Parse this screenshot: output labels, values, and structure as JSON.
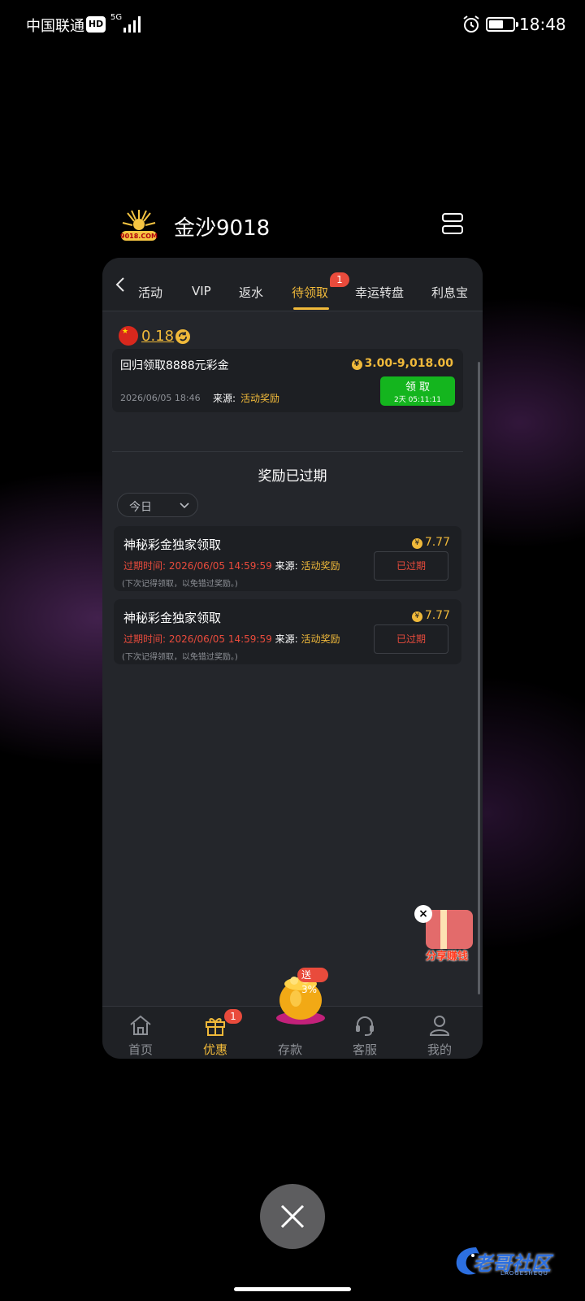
{
  "status_bar": {
    "carrier": "中国联通",
    "hd": "HD",
    "network": "5G",
    "time": "18:48",
    "battery_level": 0.6
  },
  "app": {
    "title": "金沙9018",
    "logo_text": "9018.COM"
  },
  "tabs": [
    {
      "label": "活动"
    },
    {
      "label": "VIP"
    },
    {
      "label": "返水"
    },
    {
      "label": "待领取",
      "active": true,
      "badge": "1"
    },
    {
      "label": "幸运转盘"
    },
    {
      "label": "利息宝"
    }
  ],
  "balance": {
    "flag": "china-flag-icon",
    "value": "0.18"
  },
  "pending": {
    "title": "回归领取8888元彩金",
    "currency_symbol": "¥",
    "amount_range": "3.00-9,018.00",
    "date": "2026/06/05 18:46",
    "source_label": "来源:",
    "source_value": "活动奖励",
    "claim_label": "领 取",
    "claim_timer": "2天 05:11:11"
  },
  "expired_section": {
    "title": "奖励已过期",
    "date_filter": "今日",
    "items": [
      {
        "title": "神秘彩金独家领取",
        "amount": "7.77",
        "time_label": "过期时间:",
        "time_value": "2026/06/05 14:59:59",
        "source_label": "来源:",
        "source_value": "活动奖励",
        "note": "(下次记得领取，以免错过奖励。)",
        "status": "已过期"
      },
      {
        "title": "神秘彩金独家领取",
        "amount": "7.77",
        "time_label": "过期时间:",
        "time_value": "2026/06/05 14:59:59",
        "source_label": "来源:",
        "source_value": "活动奖励",
        "note": "(下次记得领取，以免错过奖励。)",
        "status": "已过期"
      }
    ]
  },
  "share_widget": {
    "label": "分享赚钱",
    "close": "×"
  },
  "bottom_nav": [
    {
      "label": "首页",
      "icon": "home-icon"
    },
    {
      "label": "优惠",
      "icon": "gift-icon",
      "active": true,
      "badge": "1"
    },
    {
      "label": "存款",
      "icon": "gold-pot-icon",
      "badge": "送3%"
    },
    {
      "label": "客服",
      "icon": "headset-icon"
    },
    {
      "label": "我的",
      "icon": "user-icon"
    }
  ],
  "watermark": {
    "text": "老哥社区",
    "sub": "LAOGESHEQU"
  },
  "colors": {
    "accent": "#f0b93a",
    "claim_green": "#14b51e",
    "danger": "#e94b3c",
    "card_bg": "#24262b"
  }
}
